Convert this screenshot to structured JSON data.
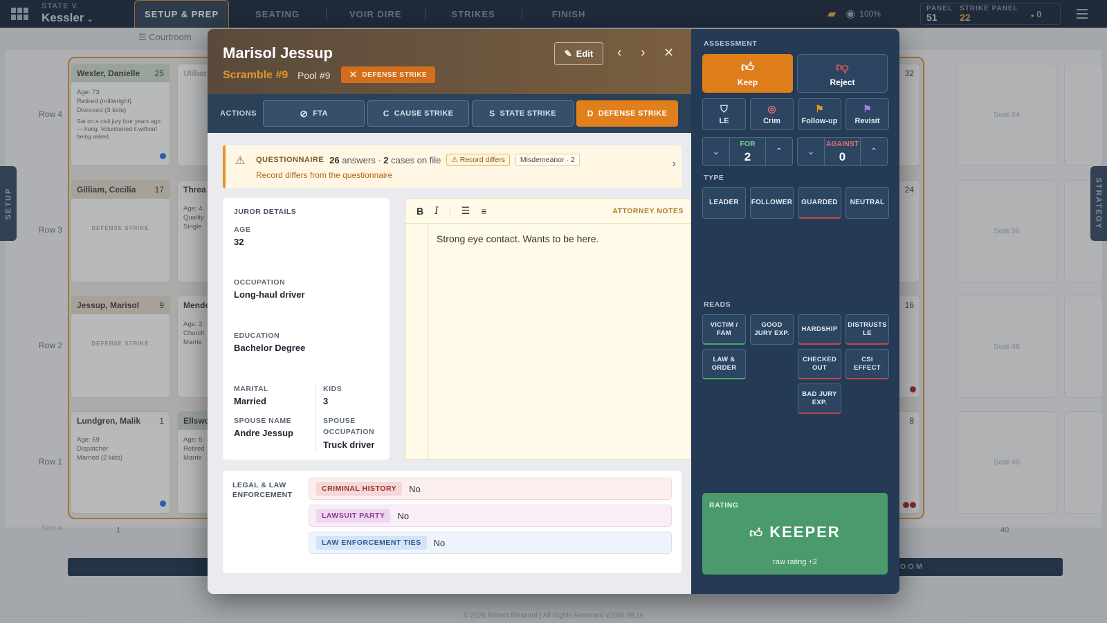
{
  "app": {
    "case_prefix": "STATE V.",
    "case_name": "Kessler",
    "tabs": [
      "SETUP & PREP",
      "SEATING",
      "VOIR DIRE",
      "STRIKES",
      "FINISH"
    ],
    "zoom": "100%",
    "panel_label": "PANEL",
    "panel_value": "51",
    "strike_panel_label": "STRIKE PANEL",
    "strike_panel_value": "22",
    "strike_count": "0",
    "subbar_label": "Courtroom",
    "footer": "© 2026 Robert Bleazard | All Rights Reserved   v2026.09.16",
    "side_left": "SETUP",
    "side_right": "STRATEGY",
    "front_bar": "T OF COURTROOM"
  },
  "background": {
    "rows": [
      "Row 4",
      "Row 3",
      "Row 2",
      "Row 1"
    ],
    "seat_label": "Seat #",
    "seat_nums": [
      "1",
      "40"
    ],
    "cards": [
      {
        "name": "Wexler, Danielle",
        "num": "25",
        "lines": [
          "Age: 73",
          "Retired (millwright)",
          "Divorced (3 kids)"
        ],
        "note": "Sat on a civil jury four years ago — hung. Volunteered it without being asked."
      },
      {
        "name": "Gilliam, Cecilia",
        "num": "17",
        "strike": "DEFENSE STRIKE"
      },
      {
        "name": "Jessup, Marisol",
        "num": "9",
        "strike": "DEFENSE STRIKE"
      },
      {
        "name": "Lundgren, Malik",
        "num": "1",
        "lines": [
          "Age: 59",
          "Dispatcher",
          "Married (2 kids)"
        ]
      }
    ],
    "partial_cards": [
      "Ulibar",
      "Threa",
      "Mende",
      "Ellswo"
    ],
    "partial_lines": [
      [
        "Age: 4",
        "Quality",
        "Single"
      ],
      [
        "Age: 2",
        "Church",
        "Marrie"
      ],
      [
        "Age: 6",
        "Retired",
        "Marrie"
      ]
    ],
    "right_nums": [
      "32",
      "24",
      "16",
      "8"
    ],
    "seats": [
      "Seat 64",
      "Seat 56",
      "Seat 48",
      "Seat 40"
    ]
  },
  "juror": {
    "name": "Marisol Jessup",
    "scramble": "Scramble #9",
    "pool": "Pool #9",
    "status_badge": "DEFENSE STRIKE",
    "edit_label": "Edit"
  },
  "actions": {
    "label": "ACTIONS",
    "buttons": [
      {
        "prefix": "⃠",
        "label": "FTA"
      },
      {
        "prefix": "C",
        "label": "CAUSE STRIKE"
      },
      {
        "prefix": "S",
        "label": "STATE STRIKE"
      },
      {
        "prefix": "D",
        "label": "DEFENSE STRIKE"
      }
    ]
  },
  "questionnaire": {
    "label": "QUESTIONNAIRE",
    "answers": "26",
    "answers_text": "answers ·",
    "cases": "2",
    "cases_text": "cases on file",
    "chip1": "Record differs",
    "chip2": "Misdemeanor · 2",
    "message": "Record differs from the questionnaire"
  },
  "details": {
    "title": "JUROR DETAILS",
    "age_label": "AGE",
    "age": "32",
    "occupation_label": "OCCUPATION",
    "occupation": "Long-haul driver",
    "education_label": "EDUCATION",
    "education": "Bachelor Degree",
    "marital_label": "MARITAL",
    "marital": "Married",
    "kids_label": "KIDS",
    "kids": "3",
    "spouse_name_label": "SPOUSE NAME",
    "spouse_name": "Andre Jessup",
    "spouse_occ_label_1": "SPOUSE",
    "spouse_occ_label_2": "OCCUPATION",
    "spouse_occ": "Truck driver"
  },
  "notes": {
    "label": "ATTORNEY NOTES",
    "text": "Strong eye contact. Wants to be here."
  },
  "legal": {
    "title": "LEGAL & LAW ENFORCEMENT",
    "rows": [
      {
        "tag": "CRIMINAL HISTORY",
        "value": "No"
      },
      {
        "tag": "LAWSUIT PARTY",
        "value": "No"
      },
      {
        "tag": "LAW ENFORCEMENT TIES",
        "value": "No"
      }
    ]
  },
  "assessment": {
    "title": "ASSESSMENT",
    "keep": "Keep",
    "reject": "Reject",
    "flags": [
      "LE",
      "Crim",
      "Follow-up",
      "Revisit"
    ],
    "for_label": "FOR",
    "for_value": "2",
    "against_label": "AGAINST",
    "against_value": "0",
    "type_title": "TYPE",
    "types": [
      "LEADER",
      "FOLLOWER",
      "GUARDED",
      "NEUTRAL"
    ],
    "reads_title": "READS",
    "reads": [
      "VICTIM / FAM",
      "GOOD JURY EXP.",
      "HARDSHIP",
      "DISTRUSTS LE",
      "LAW & ORDER",
      "CHECKED OUT",
      "CSI EFFECT",
      "BAD JURY EXP."
    ],
    "rating_label": "RATING",
    "rating_value": "KEEPER",
    "raw_rating": "raw rating +2"
  },
  "colors": {
    "accent_orange": "#e07f1b",
    "navy": "#243a55",
    "keeper_green": "#4a9a6c",
    "reject_red": "#e05555"
  }
}
